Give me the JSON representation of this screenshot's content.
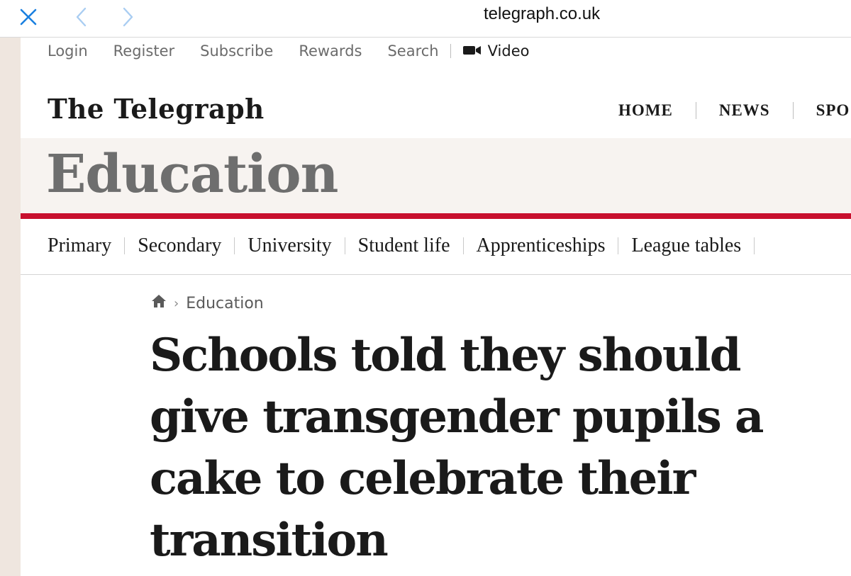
{
  "browser": {
    "url": "telegraph.co.uk"
  },
  "utility_nav": {
    "items": [
      "Login",
      "Register",
      "Subscribe",
      "Rewards",
      "Search"
    ],
    "video_label": "Video"
  },
  "masthead": {
    "logo_text": "The Telegraph",
    "main_nav": [
      "HOME",
      "NEWS",
      "SPO"
    ]
  },
  "section": {
    "title": "Education",
    "accent_color": "#c8102e"
  },
  "sub_nav": {
    "items": [
      "Primary",
      "Secondary",
      "University",
      "Student life",
      "Apprenticeships",
      "League tables"
    ]
  },
  "breadcrumb": {
    "section": "Education"
  },
  "article": {
    "headline": "Schools told they should give transgender pupils a cake to celebrate their transition"
  }
}
